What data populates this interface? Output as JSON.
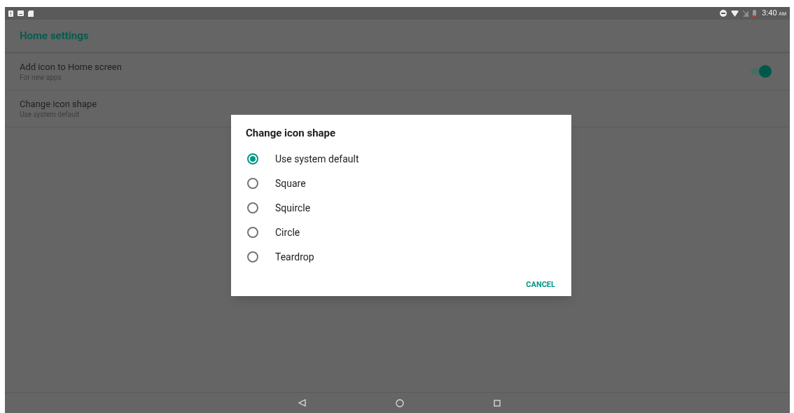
{
  "status_bar": {
    "time": "3:40",
    "meridiem": "AM"
  },
  "app_bar": {
    "title": "Home settings"
  },
  "settings": [
    {
      "title": "Add icon to Home screen",
      "summary": "For new apps",
      "kind": "switch",
      "on": true
    },
    {
      "title": "Change icon shape",
      "summary": "Use system default",
      "kind": "plain"
    }
  ],
  "dialog": {
    "title": "Change icon shape",
    "options": [
      {
        "label": "Use system default",
        "selected": true
      },
      {
        "label": "Square",
        "selected": false
      },
      {
        "label": "Squircle",
        "selected": false
      },
      {
        "label": "Circle",
        "selected": false
      },
      {
        "label": "Teardrop",
        "selected": false
      }
    ],
    "button": "CANCEL"
  }
}
